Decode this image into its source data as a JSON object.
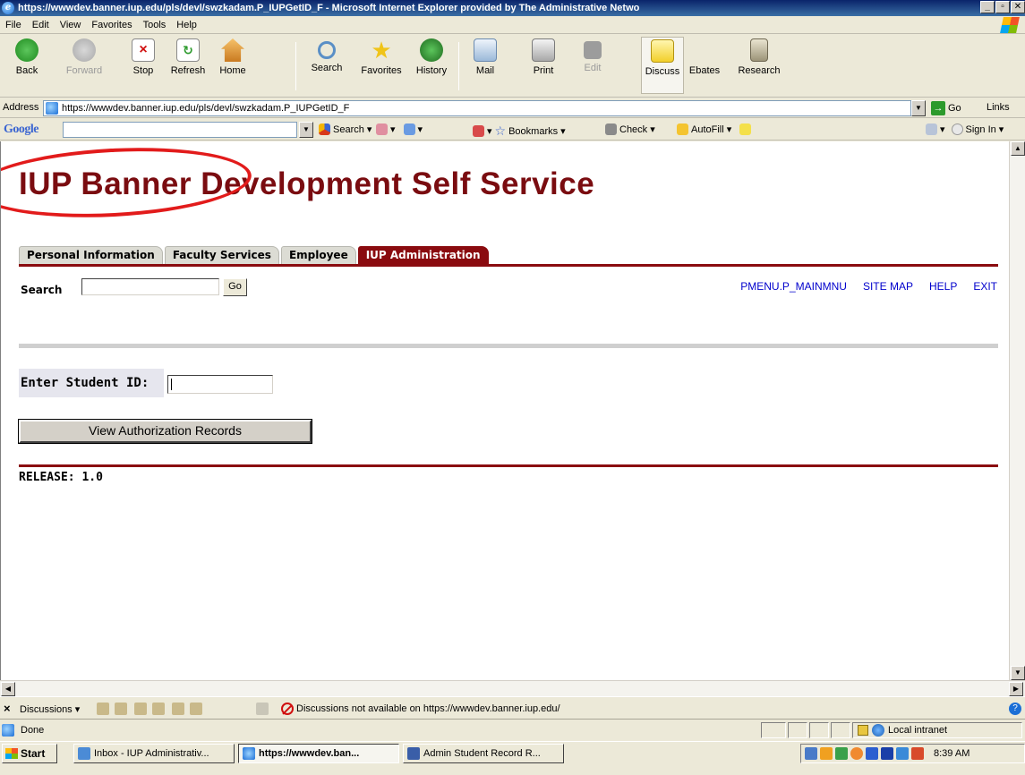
{
  "window": {
    "title": "https://wwwdev.banner.iup.edu/pls/devl/swzkadam.P_IUPGetID_F - Microsoft Internet Explorer provided by The Administrative Netwo",
    "buttons": [
      "_",
      "▫",
      "✕"
    ]
  },
  "menu": [
    "File",
    "Edit",
    "View",
    "Favorites",
    "Tools",
    "Help"
  ],
  "toolbar": {
    "back": "Back",
    "forward": "Forward",
    "stop": "Stop",
    "refresh": "Refresh",
    "home": "Home",
    "search": "Search",
    "favorites": "Favorites",
    "history": "History",
    "mail": "Mail",
    "print": "Print",
    "edit": "Edit",
    "discuss": "Discuss",
    "ebates": "Ebates",
    "research": "Research"
  },
  "address": {
    "label": "Address",
    "url": "https://wwwdev.banner.iup.edu/pls/devl/swzkadam.P_IUPGetID_F",
    "go": "Go",
    "links": "Links"
  },
  "googlebar": {
    "logo": "Google",
    "search": "Search",
    "bookmarks": "Bookmarks",
    "check": "Check",
    "autofill": "AutoFill",
    "sign_in": "Sign In"
  },
  "page": {
    "title": "IUP Banner Development Self Service",
    "tabs": [
      "Personal Information",
      "Faculty Services",
      "Employee",
      "IUP Administration"
    ],
    "active_tab": "IUP Administration",
    "search_label": "Search",
    "search_value": "",
    "search_go": "Go",
    "links": [
      "PMENU.P_MAINMNU",
      "SITE MAP",
      "HELP",
      "EXIT"
    ],
    "student_id_label": "Enter Student ID:",
    "student_id_value": "",
    "view_button": "View Authorization Records",
    "release": "RELEASE: 1.0",
    "colors": {
      "accent": "#8a0b0f",
      "link": "#0000cc",
      "annotation": "#e21b1b"
    }
  },
  "discussions": {
    "label": "Discussions",
    "message": "Discussions not available on https://wwwdev.banner.iup.edu/"
  },
  "status": {
    "text": "Done",
    "zone": "Local intranet"
  },
  "taskbar": {
    "start": "Start",
    "tasks": [
      "Inbox - IUP Administrativ...",
      "https://wwwdev.ban...",
      "Admin Student Record R..."
    ],
    "clock": "8:39 AM"
  }
}
